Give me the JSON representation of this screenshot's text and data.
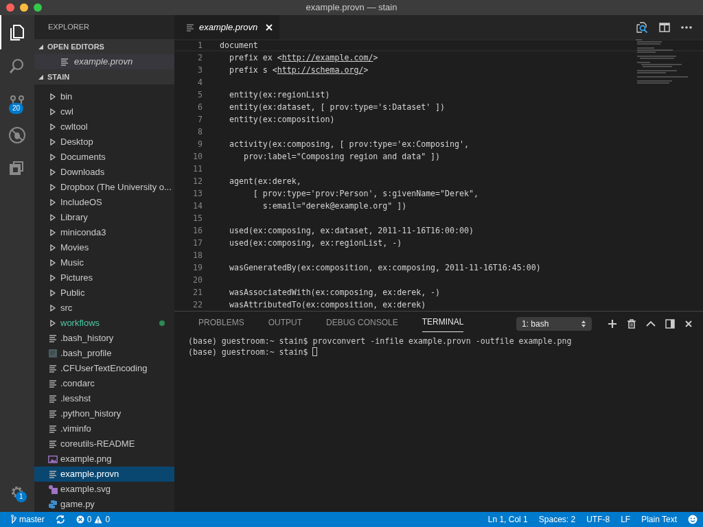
{
  "window": {
    "title": "example.provn — stain"
  },
  "activity_bar": {
    "items": [
      {
        "kind": "explorer",
        "selected": true
      },
      {
        "kind": "search",
        "selected": false
      },
      {
        "kind": "source-control",
        "selected": false,
        "badge": "20"
      },
      {
        "kind": "debug",
        "selected": false
      },
      {
        "kind": "extensions",
        "selected": false
      }
    ],
    "settings_badge": "1"
  },
  "sidebar": {
    "title": "EXPLORER",
    "open_editors": {
      "label": "OPEN EDITORS",
      "expanded": true,
      "items": [
        {
          "name": "example.provn",
          "italic": true
        }
      ]
    },
    "folder": {
      "label": "STAIN",
      "expanded": true,
      "items": [
        {
          "name": "bin",
          "kind": "folder",
          "selected": false
        },
        {
          "name": "cwl",
          "kind": "folder",
          "selected": false
        },
        {
          "name": "cwltool",
          "kind": "folder",
          "selected": false
        },
        {
          "name": "Desktop",
          "kind": "folder",
          "selected": false
        },
        {
          "name": "Documents",
          "kind": "folder",
          "selected": false
        },
        {
          "name": "Downloads",
          "kind": "folder",
          "selected": false
        },
        {
          "name": "Dropbox (The University o...",
          "kind": "folder",
          "selected": false
        },
        {
          "name": "IncludeOS",
          "kind": "folder",
          "selected": false
        },
        {
          "name": "Library",
          "kind": "folder",
          "selected": false
        },
        {
          "name": "miniconda3",
          "kind": "folder",
          "selected": false
        },
        {
          "name": "Movies",
          "kind": "folder",
          "selected": false
        },
        {
          "name": "Music",
          "kind": "folder",
          "selected": false
        },
        {
          "name": "Pictures",
          "kind": "folder",
          "selected": false
        },
        {
          "name": "Public",
          "kind": "folder",
          "selected": false
        },
        {
          "name": "src",
          "kind": "folder",
          "selected": false
        },
        {
          "name": "workflows",
          "kind": "folder",
          "selected": false,
          "untracked": true
        },
        {
          "name": ".bash_history",
          "kind": "text",
          "selected": false
        },
        {
          "name": ".bash_profile",
          "kind": "doc",
          "selected": false
        },
        {
          "name": ".CFUserTextEncoding",
          "kind": "text",
          "selected": false
        },
        {
          "name": ".condarc",
          "kind": "text",
          "selected": false
        },
        {
          "name": ".lesshst",
          "kind": "text",
          "selected": false
        },
        {
          "name": ".python_history",
          "kind": "text",
          "selected": false
        },
        {
          "name": ".viminfo",
          "kind": "text",
          "selected": false
        },
        {
          "name": "coreutils-README",
          "kind": "text",
          "selected": false
        },
        {
          "name": "example.png",
          "kind": "image",
          "selected": false
        },
        {
          "name": "example.provn",
          "kind": "text",
          "selected": true
        },
        {
          "name": "example.svg",
          "kind": "svg",
          "selected": false
        },
        {
          "name": "game.py",
          "kind": "python",
          "selected": false
        }
      ]
    }
  },
  "editor": {
    "tabs": [
      {
        "label": "example.provn",
        "italic": true,
        "selected": true
      }
    ],
    "lines": [
      {
        "number": "1",
        "text": "document"
      },
      {
        "number": "2",
        "text": "  prefix ex <",
        "link": "http://example.com/",
        "tail": ">"
      },
      {
        "number": "3",
        "text": "  prefix s <",
        "link": "http://schema.org/",
        "tail": ">"
      },
      {
        "number": "4"
      },
      {
        "number": "5",
        "text": "  entity(ex:regionList)"
      },
      {
        "number": "6",
        "text": "  entity(ex:dataset, [ prov:type='s:Dataset' ])"
      },
      {
        "number": "7",
        "text": "  entity(ex:composition)"
      },
      {
        "number": "8"
      },
      {
        "number": "9",
        "text": "  activity(ex:composing, [ prov:type='ex:Composing',"
      },
      {
        "number": "10",
        "text": "     prov:label=\"Composing region and data\" ])"
      },
      {
        "number": "11"
      },
      {
        "number": "12",
        "text": "  agent(ex:derek,"
      },
      {
        "number": "13",
        "text": "       [ prov:type='prov:Person', s:givenName=\"Derek\","
      },
      {
        "number": "14",
        "text": "         s:email=\"derek@example.org\" ])"
      },
      {
        "number": "15"
      },
      {
        "number": "16",
        "text": "  used(ex:composing, ex:dataset, 2011-11-16T16:00:00)"
      },
      {
        "number": "17",
        "text": "  used(ex:composing, ex:regionList, -)"
      },
      {
        "number": "18"
      },
      {
        "number": "19",
        "text": "  wasGeneratedBy(ex:composition, ex:composing, 2011-11-16T16:45:00)"
      },
      {
        "number": "20"
      },
      {
        "number": "21",
        "text": "  wasAssociatedWith(ex:composing, ex:derek, -)"
      },
      {
        "number": "22",
        "text": "  wasAttributedTo(ex:composition, ex:derek)"
      }
    ]
  },
  "panel": {
    "tabs": [
      {
        "label": "PROBLEMS",
        "selected": false
      },
      {
        "label": "OUTPUT",
        "selected": false
      },
      {
        "label": "DEBUG CONSOLE",
        "selected": false
      },
      {
        "label": "TERMINAL",
        "selected": true
      }
    ],
    "terminal_select": "1: bash",
    "terminal_lines": [
      "(base) guestroom:~ stain$ provconvert -infile example.provn -outfile example.png",
      "(base) guestroom:~ stain$ "
    ]
  },
  "status_bar": {
    "branch": "master",
    "errors": "0",
    "warnings": "0",
    "items": [
      "Ln 1, Col 1",
      "Spaces: 2",
      "UTF-8",
      "LF",
      "Plain Text"
    ]
  }
}
